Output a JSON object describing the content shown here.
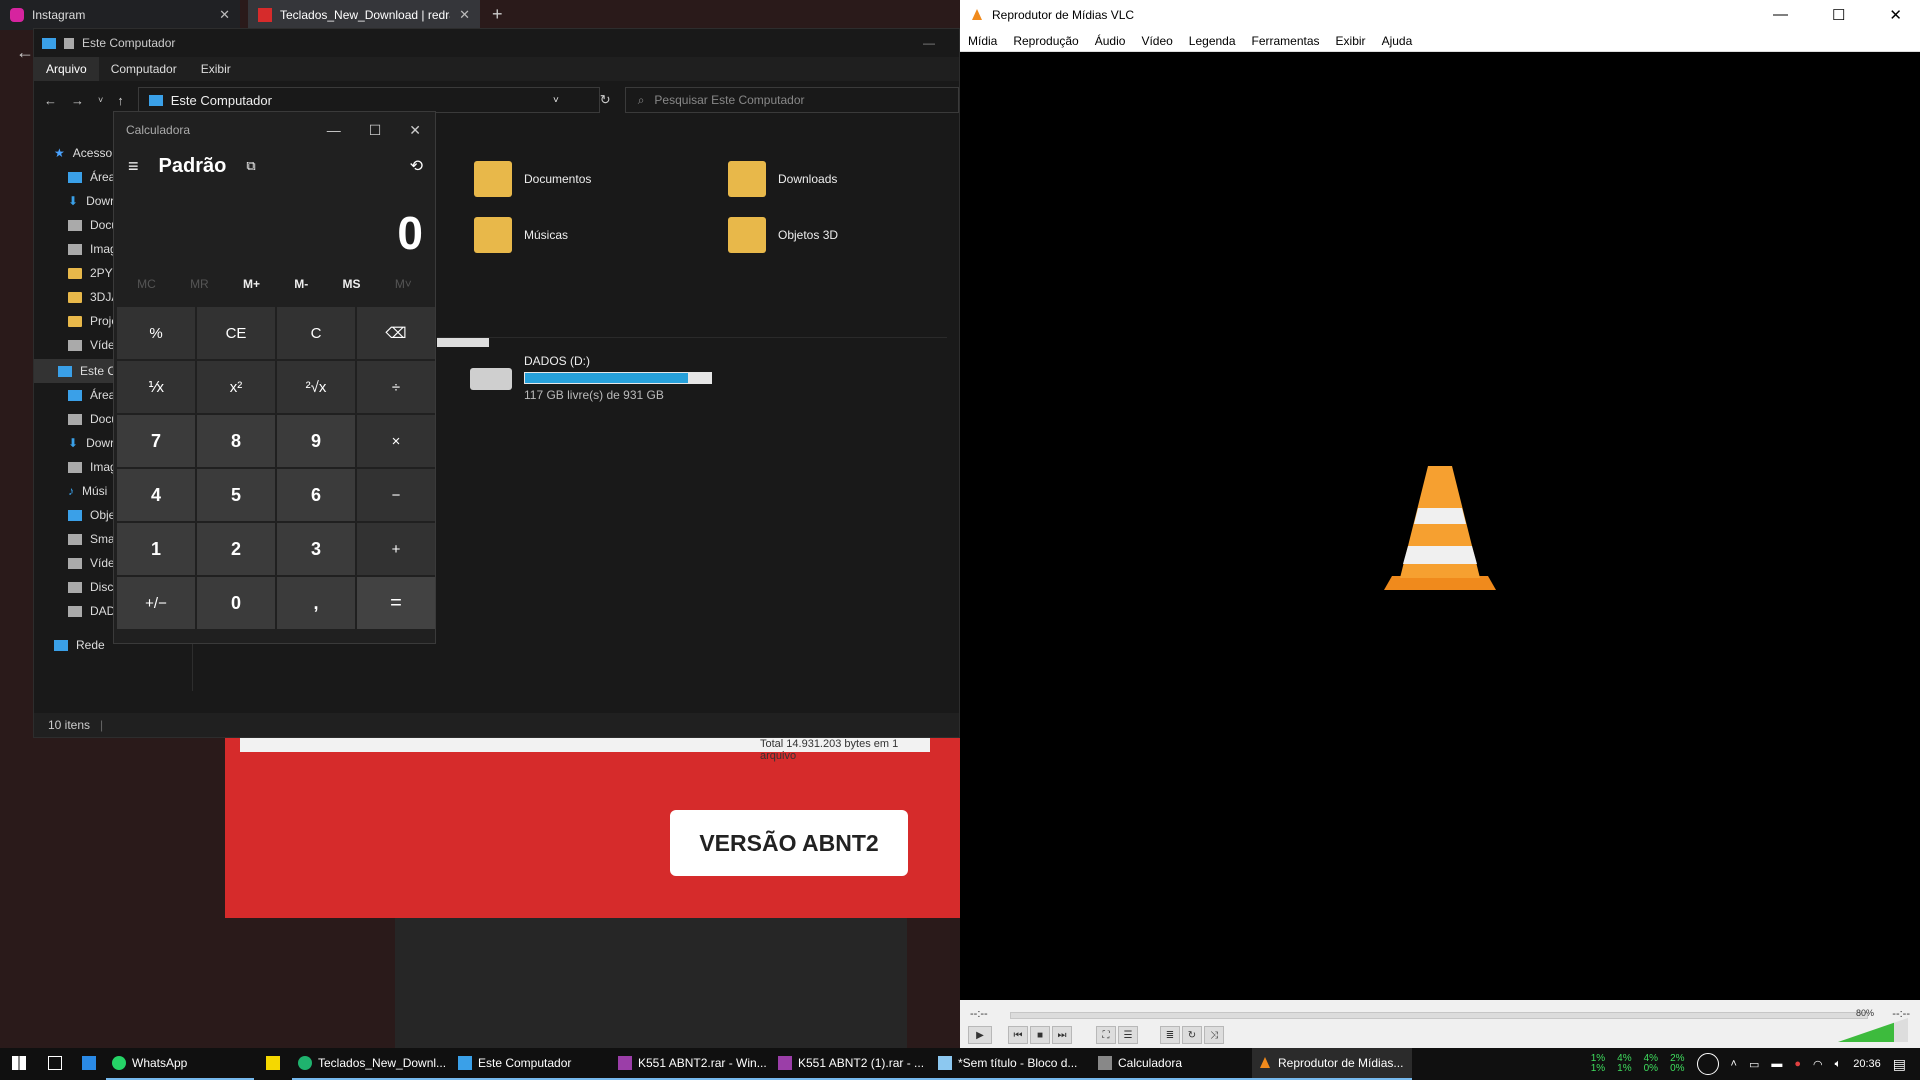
{
  "browser": {
    "tabs": [
      {
        "title": "Instagram"
      },
      {
        "title": "Teclados_New_Download | redra"
      }
    ],
    "webpage": {
      "button_label": "VERSÃO ABNT2",
      "status_text": "Total 14.931.203 bytes em 1 arquivo"
    }
  },
  "explorer": {
    "title": "Este Computador",
    "ribbon": [
      "Arquivo",
      "Computador",
      "Exibir"
    ],
    "address": "Este Computador",
    "search_placeholder": "Pesquisar Este Computador",
    "nav_items": [
      "Acesso",
      "Área",
      "Dowr",
      "Docu",
      "Imag",
      "2PYT",
      "3DJA",
      "Proje",
      "Víde",
      "Este Co",
      "Área",
      "Docu",
      "Dowr",
      "Imag",
      "Músi",
      "Objet",
      "Smar",
      "Víde",
      "Disco",
      "DADO",
      "Rede"
    ],
    "folders": [
      {
        "name": "Documentos"
      },
      {
        "name": "Downloads"
      },
      {
        "name": "Músicas"
      },
      {
        "name": "Objetos 3D"
      }
    ],
    "drive": {
      "name": "DADOS (D:)",
      "free": "117 GB livre(s) de 931 GB",
      "used_fraction": 0.874
    },
    "status": "10 itens"
  },
  "calculator": {
    "title": "Calculadora",
    "mode": "Padrão",
    "display": "0",
    "memory": [
      {
        "label": "MC",
        "enabled": false
      },
      {
        "label": "MR",
        "enabled": false
      },
      {
        "label": "M+",
        "enabled": true
      },
      {
        "label": "M-",
        "enabled": true
      },
      {
        "label": "MS",
        "enabled": true
      },
      {
        "label": "M˅",
        "enabled": false
      }
    ],
    "keys": [
      "%",
      "CE",
      "C",
      "⌫",
      "⅟x",
      "x²",
      "²√x",
      "÷",
      "7",
      "8",
      "9",
      "×",
      "4",
      "5",
      "6",
      "−",
      "1",
      "2",
      "3",
      "+",
      "+/−",
      "0",
      ",",
      "="
    ]
  },
  "vlc": {
    "title": "Reprodutor de Mídias VLC",
    "menu": [
      "Mídia",
      "Reprodução",
      "Áudio",
      "Vídeo",
      "Legenda",
      "Ferramentas",
      "Exibir",
      "Ajuda"
    ],
    "time_left": "--:--",
    "time_right": "--:--",
    "volume": "80%"
  },
  "taskbar": {
    "items": [
      {
        "label": "WhatsApp"
      },
      {
        "label": "Teclados_New_Downl..."
      },
      {
        "label": "Este Computador"
      },
      {
        "label": "K551 ABNT2.rar - Win..."
      },
      {
        "label": "K551 ABNT2 (1).rar - ..."
      },
      {
        "label": "*Sem título - Bloco d..."
      },
      {
        "label": "Calculadora"
      },
      {
        "label": "Reprodutor de Mídias..."
      }
    ],
    "meters": [
      [
        "1%",
        "1%"
      ],
      [
        "4%",
        "1%"
      ],
      [
        "4%",
        "0%"
      ],
      [
        "2%",
        "0%"
      ]
    ],
    "clock": "20:36"
  },
  "colors": {
    "accent": "#76b9ed",
    "vlc_orange": "#f08a1c",
    "web_red": "#d62b2b"
  }
}
